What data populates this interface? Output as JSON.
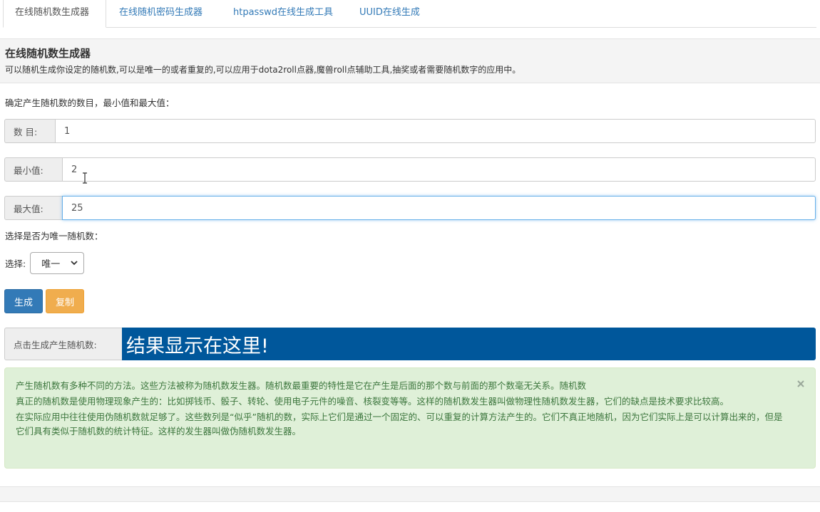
{
  "tabs": [
    {
      "label": "在线随机数生成器",
      "active": true
    },
    {
      "label": "在线随机密码生成器",
      "active": false
    },
    {
      "label": "htpasswd在线生成工具",
      "active": false
    },
    {
      "label": "UUID在线生成",
      "active": false
    }
  ],
  "header": {
    "title": "在线随机数生成器",
    "description": "可以随机生成你设定的随机数,可以是唯一的或者重复的,可以应用于dota2roll点器,魔兽roll点辅助工具,抽奖或者需要随机数字的应用中。"
  },
  "form": {
    "intro": "确定产生随机数的数目，最小值和最大值：",
    "count": {
      "label": "数 目:",
      "value": "1"
    },
    "min": {
      "label": "最小值:",
      "value": "2"
    },
    "max": {
      "label": "最大值:",
      "value": "25"
    },
    "unique_prompt": "选择是否为唯一随机数：",
    "select_label": "选择:",
    "select_value": "唯一",
    "generate_label": "生成",
    "copy_label": "复制"
  },
  "result": {
    "label": "点击生成产生随机数:",
    "value": "结果显示在这里!"
  },
  "info": {
    "paragraphs": [
      "产生随机数有多种不同的方法。这些方法被称为随机数发生器。随机数最重要的特性是它在产生是后面的那个数与前面的那个数毫无关系。随机数",
      "真正的随机数是使用物理现象产生的：比如掷钱币、骰子、转轮、使用电子元件的噪音、核裂变等等。这样的随机数发生器叫做物理性随机数发生器，它们的缺点是技术要求比较高。",
      "在实际应用中往往使用伪随机数就足够了。这些数列是“似乎”随机的数，实际上它们是通过一个固定的、可以重复的计算方法产生的。它们不真正地随机，因为它们实际上是可以计算出来的，但是它们具有类似于随机数的统计特征。这样的发生器叫做伪随机数发生器。"
    ],
    "close_symbol": "×"
  },
  "colors": {
    "link": "#337ab7",
    "primary": "#337ab7",
    "warning": "#f0ad4e",
    "result_bg": "#00579b",
    "alert_bg": "#dff0d8",
    "alert_text": "#3c763d"
  }
}
